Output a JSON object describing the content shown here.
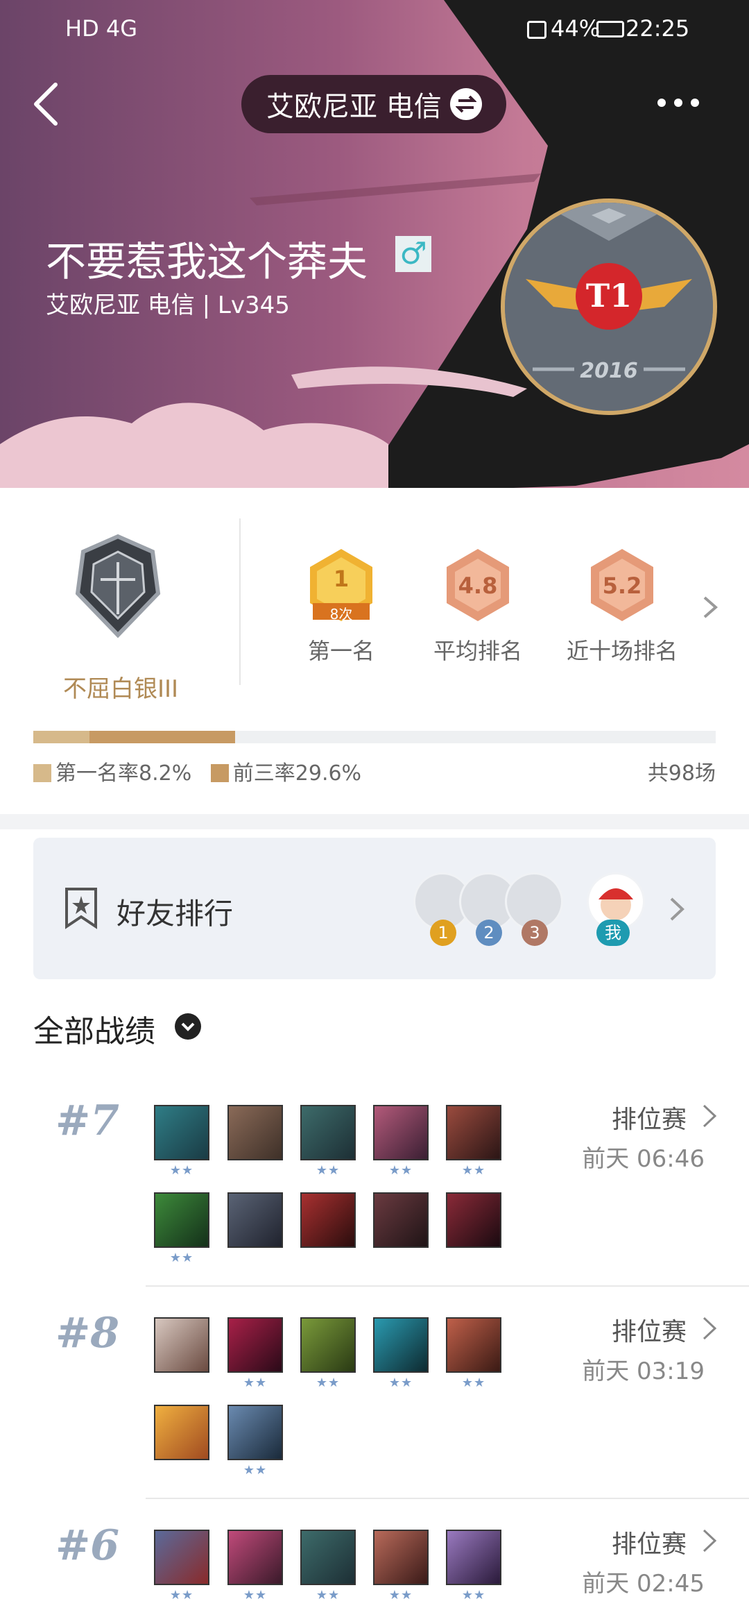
{
  "status_bar": {
    "left_icons": "HD 4G",
    "battery": "44%",
    "time": "22:25"
  },
  "header": {
    "server": "艾欧尼亚 电信"
  },
  "profile": {
    "name": "不要惹我这个莽夫",
    "gender_symbol": "♂",
    "sub": "艾欧尼亚 电信 | Lv345",
    "avatar_text": "2016"
  },
  "rank": {
    "name": "不屈白银III"
  },
  "stats": [
    {
      "value": "1",
      "extra": "8次",
      "label": "第一名"
    },
    {
      "value": "4.8",
      "label": "平均排名"
    },
    {
      "value": "5.2",
      "label": "近十场排名"
    }
  ],
  "rates": {
    "first_rate": 0.082,
    "top3_rate": 0.296,
    "first_label": "第一名率8.2%",
    "top3_label": "前三率29.6%",
    "total": "共98场"
  },
  "friends": {
    "title": "好友排行",
    "ranks": [
      "1",
      "2",
      "3"
    ],
    "me": "我"
  },
  "records": {
    "title": "全部战绩",
    "matches": [
      {
        "rank": "#7",
        "type": "排位赛",
        "time": "前天 06:46"
      },
      {
        "rank": "#8",
        "type": "排位赛",
        "time": "前天 03:19"
      },
      {
        "rank": "#6",
        "type": "排位赛",
        "time": "前天 02:45"
      }
    ]
  },
  "colors": {
    "gold": "#f0b232",
    "bronze": "#e59a78",
    "rate_first": "#d6b98a",
    "rate_top3": "#c79a63"
  }
}
